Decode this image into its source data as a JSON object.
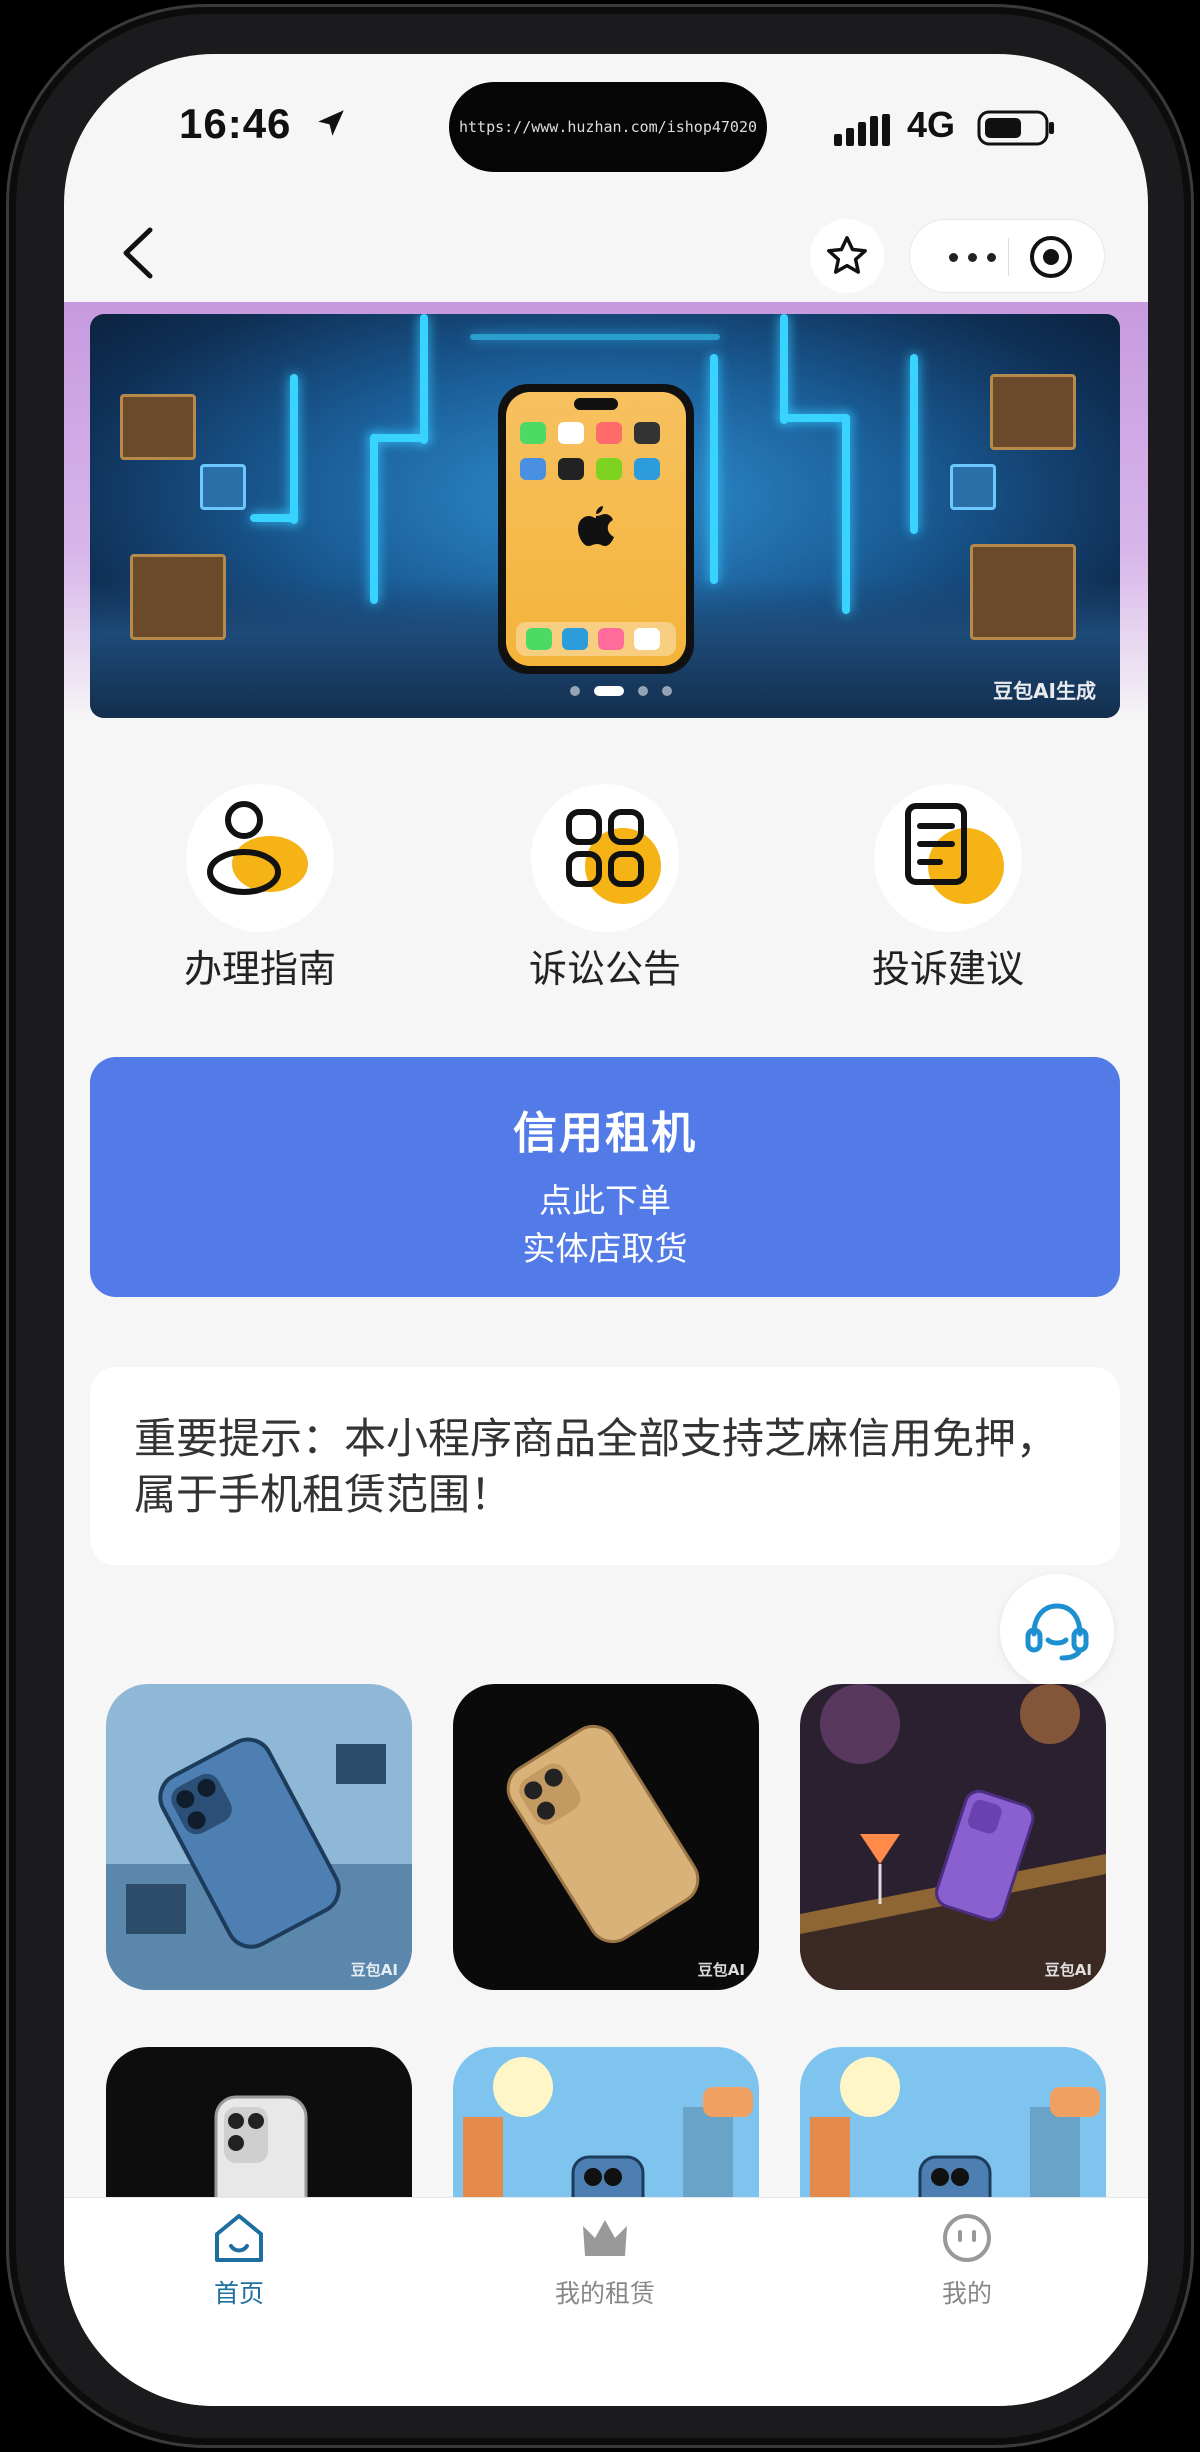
{
  "status_bar": {
    "time": "16:46",
    "url": "https://www.huzhan.com/ishop47020",
    "network": "4G"
  },
  "nav": {
    "back_icon": "chevron-left-icon",
    "favorite_icon": "star-icon",
    "more_icon": "more-dots-icon",
    "close_icon": "target-icon"
  },
  "banner": {
    "watermark": "豆包AI生成",
    "active_index": 0,
    "slide_count": 4
  },
  "quick_entries": [
    {
      "label": "办理指南",
      "icon": "user-guide-icon"
    },
    {
      "label": "诉讼公告",
      "icon": "grid-apps-icon"
    },
    {
      "label": "投诉建议",
      "icon": "document-icon"
    }
  ],
  "cta": {
    "title": "信用租机",
    "line1": "点此下单",
    "line2": "实体店取货"
  },
  "notice": {
    "text": "重要提示：本小程序商品全部支持芝麻信用免押，属于手机租赁范围！"
  },
  "products": [
    {
      "name": "blue-phone-on-circuit",
      "watermark": "豆包AI"
    },
    {
      "name": "gold-phone-on-black",
      "watermark": "豆包AI"
    },
    {
      "name": "purple-phone-on-bar",
      "watermark": "豆包AI"
    },
    {
      "name": "silver-phone-on-curtain",
      "watermark": ""
    },
    {
      "name": "blue-phone-cartoon-city-1",
      "watermark": ""
    },
    {
      "name": "blue-phone-cartoon-city-2",
      "watermark": ""
    }
  ],
  "tabbar": {
    "items": [
      {
        "label": "首页",
        "icon": "home-icon",
        "active": true
      },
      {
        "label": "我的租赁",
        "icon": "crown-icon",
        "active": false
      },
      {
        "label": "我的",
        "icon": "smiley-icon",
        "active": false
      }
    ],
    "active_color": "#1e6fa0",
    "inactive_color": "#888888"
  },
  "colors": {
    "cta_bg": "#537be8",
    "accent_yellow": "#f5b316",
    "page_bg": "#f6f6f6"
  }
}
